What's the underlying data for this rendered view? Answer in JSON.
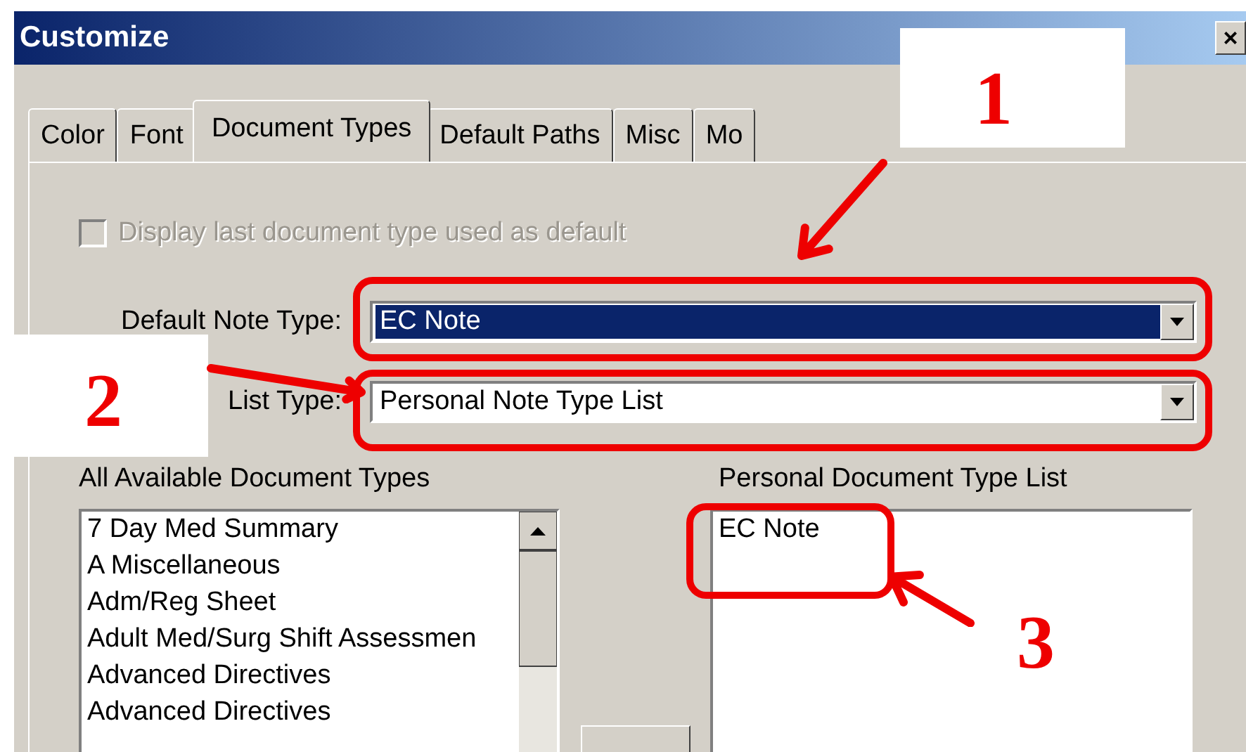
{
  "window": {
    "title": "Customize",
    "close": "×"
  },
  "tabs": [
    {
      "label": "Color",
      "selected": false
    },
    {
      "label": "Font",
      "selected": false
    },
    {
      "label": "Document Types",
      "selected": true
    },
    {
      "label": "Default Paths",
      "selected": false
    },
    {
      "label": "Misc",
      "selected": false
    },
    {
      "label": "Mo",
      "selected": false
    }
  ],
  "display_last_default": {
    "label": "Display last document type used as default",
    "checked": false,
    "disabled": true
  },
  "default_note_type": {
    "label": "Default Note Type:",
    "value": "EC Note",
    "selected": true
  },
  "list_type": {
    "label": "List Type:",
    "value": "Personal Note Type List",
    "selected": false
  },
  "available": {
    "label": "All Available Document Types",
    "items": [
      "7 Day Med Summary",
      "A Miscellaneous",
      "Adm/Reg Sheet",
      "Adult Med/Surg Shift Assessmen",
      "Advanced Directives",
      "Advanced Directives"
    ]
  },
  "personal": {
    "label": "Personal Document Type List",
    "items": [
      "EC Note"
    ]
  },
  "annotations": [
    {
      "number": "1"
    },
    {
      "number": "2"
    },
    {
      "number": "3"
    }
  ]
}
